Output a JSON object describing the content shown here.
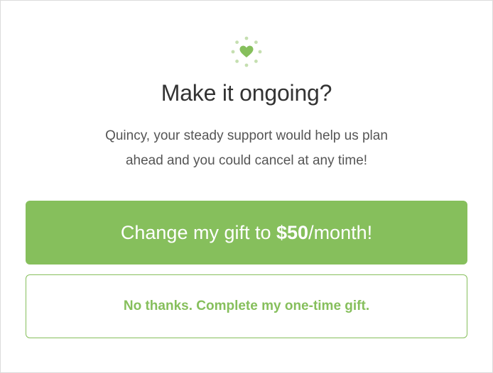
{
  "dialog": {
    "icon": "heart-burst-icon",
    "title": "Make it ongoing?",
    "subtitle_line1": "Quincy, your steady support would help us plan",
    "subtitle_line2": "ahead and you could cancel at any time!"
  },
  "primary_button": {
    "prefix": "Change my gift to ",
    "amount": "$50",
    "suffix": "/month!"
  },
  "secondary_button": {
    "label": "No thanks. Complete my one-time gift."
  },
  "colors": {
    "accent": "#86bf5c",
    "accent_light": "#c5dfb0",
    "title": "#333333",
    "text": "#555555",
    "border": "#dcdcdc"
  }
}
